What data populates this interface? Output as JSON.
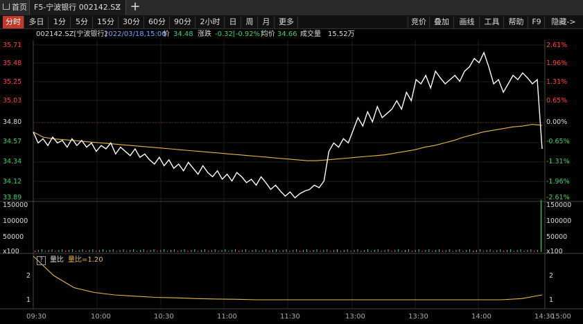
{
  "window": {
    "home_tab": "首页",
    "active_tab": "F5-宁波银行 002142.SZ",
    "close": "✕",
    "add": "+"
  },
  "toolbar": {
    "left": [
      "分时",
      "多日",
      "1分",
      "5分",
      "15分",
      "30分",
      "60分",
      "90分",
      "2小时",
      "日",
      "周",
      "月",
      "更多"
    ],
    "selected": "分时",
    "right": [
      "竞价",
      "叠加",
      "画线",
      "工具",
      "帮助",
      "F9",
      "隐藏->"
    ]
  },
  "info": {
    "code": "002142.SZ[宁波银行]",
    "datetime": "2022/03/18,15:00",
    "price_label": "价",
    "price": "34.48",
    "change_label": "涨跌",
    "change": "-0.32[-0.92%]",
    "avg_label": "均价",
    "avg": "34.66",
    "volume_label": "成交量",
    "volume": "15.52万"
  },
  "price_axis": {
    "left": [
      "35.71",
      "35.48",
      "35.25",
      "35.03",
      "34.80",
      "34.57",
      "34.34",
      "34.12",
      "33.89"
    ],
    "right": [
      "2.61%",
      "1.96%",
      "1.31%",
      "0.65%",
      "0.00%",
      "-0.65%",
      "-1.31%",
      "-1.96%",
      "-2.61%"
    ],
    "prev_close": 34.8
  },
  "volume_axis": {
    "labels": [
      "150000",
      "100000",
      "50000"
    ],
    "unit": "x100"
  },
  "ratio_panel": {
    "help": "?",
    "title": "量比",
    "value_text": "量比=1.20",
    "labels": [
      "2",
      "1"
    ]
  },
  "time_axis": [
    "09:30",
    "10:00",
    "10:30",
    "11:00",
    "11:30",
    "13:00",
    "13:30",
    "14:00",
    "14:30",
    "15:00"
  ],
  "colors": {
    "up": "#ff4040",
    "down": "#3bd16f",
    "price_line": "#ffffff",
    "avg_line": "#e8b84a",
    "selected_tab": "#c0392b"
  },
  "chart_data": {
    "type": "line",
    "x_range": [
      "09:30",
      "15:00"
    ],
    "ylim": [
      33.89,
      35.71
    ],
    "series": [
      {
        "name": "价",
        "values": [
          34.68,
          34.55,
          34.6,
          34.52,
          34.62,
          34.55,
          34.58,
          34.5,
          34.6,
          34.52,
          34.58,
          34.5,
          34.55,
          34.45,
          34.52,
          34.48,
          34.55,
          34.42,
          34.5,
          34.45,
          34.4,
          34.48,
          34.38,
          34.42,
          34.35,
          34.3,
          34.38,
          34.28,
          34.35,
          34.25,
          34.3,
          34.22,
          34.32,
          34.25,
          34.18,
          34.28,
          34.2,
          34.15,
          34.22,
          34.12,
          34.18,
          34.1,
          34.2,
          34.15,
          34.08,
          34.12,
          34.05,
          34.15,
          34.08,
          34.0,
          34.05,
          33.98,
          33.92,
          33.97,
          33.9,
          33.95,
          33.98,
          34.0,
          34.05,
          34.02,
          34.1,
          34.45,
          34.55,
          34.5,
          34.6,
          34.55,
          34.7,
          34.85,
          34.75,
          34.92,
          34.8,
          34.98,
          34.85,
          34.9,
          34.95,
          35.05,
          34.95,
          35.15,
          35.05,
          35.3,
          35.25,
          35.35,
          35.2,
          35.4,
          35.32,
          35.25,
          35.3,
          35.35,
          35.28,
          35.4,
          35.45,
          35.55,
          35.5,
          35.62,
          35.45,
          35.25,
          35.3,
          35.15,
          35.25,
          35.35,
          35.3,
          35.38,
          35.32,
          35.25,
          35.3,
          34.48
        ]
      },
      {
        "name": "均价",
        "values": [
          34.68,
          34.62,
          34.6,
          34.59,
          34.58,
          34.57,
          34.56,
          34.55,
          34.54,
          34.53,
          34.52,
          34.51,
          34.5,
          34.49,
          34.48,
          34.47,
          34.46,
          34.45,
          34.44,
          34.43,
          34.42,
          34.41,
          34.4,
          34.39,
          34.38,
          34.37,
          34.36,
          34.35,
          34.34,
          34.34,
          34.35,
          34.36,
          34.37,
          34.38,
          34.39,
          34.4,
          34.41,
          34.43,
          34.45,
          34.47,
          34.5,
          34.52,
          34.55,
          34.58,
          34.62,
          34.65,
          34.68,
          34.7,
          34.72,
          34.74,
          34.75,
          34.77,
          34.76
        ]
      }
    ],
    "volume_ratio": [
      2.8,
      2.0,
      1.5,
      1.3,
      1.2,
      1.15,
      1.1,
      1.08,
      1.05,
      1.03,
      1.02,
      1.0,
      1.0,
      1.0,
      1.0,
      1.0,
      1.0,
      1.0,
      1.0,
      1.0,
      1.0,
      1.0,
      1.0,
      1.0,
      1.05,
      1.2
    ]
  }
}
